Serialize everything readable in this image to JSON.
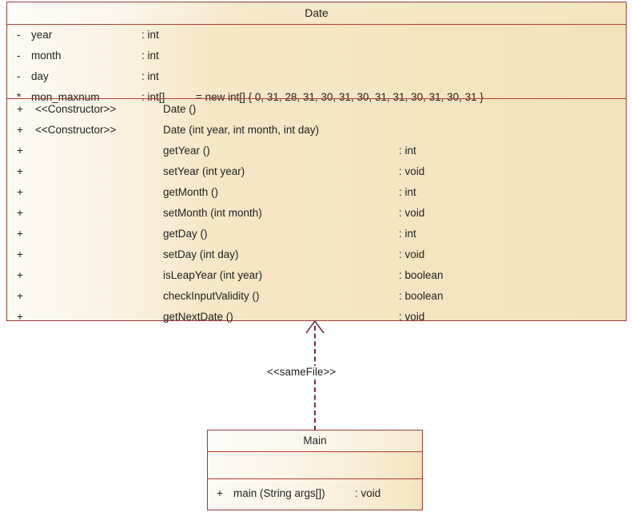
{
  "diagram": {
    "type": "uml-class-diagram",
    "background_color": "#ffffff",
    "class_border_color": "#9b3a35",
    "class_fill_start": "#fdfaf4",
    "class_fill_end": "#f4e2bb",
    "relationship_color": "#7a2a46"
  },
  "date_class": {
    "name": "Date",
    "attributes": [
      {
        "visibility": "-",
        "name": "year",
        "type": ": int",
        "initial": ""
      },
      {
        "visibility": "-",
        "name": "month",
        "type": ": int",
        "initial": ""
      },
      {
        "visibility": "-",
        "name": "day",
        "type": ": int",
        "initial": ""
      },
      {
        "visibility": "*",
        "name": "mon_maxnum",
        "type": ": int[]",
        "initial": "= new int[] { 0, 31, 28, 31, 30, 31, 30, 31, 31, 30, 31, 30, 31 }"
      }
    ],
    "operations": [
      {
        "visibility": "+",
        "stereotype": "<<Constructor>>",
        "signature": "Date ()",
        "returns": ""
      },
      {
        "visibility": "+",
        "stereotype": "<<Constructor>>",
        "signature": "Date (int year, int month, int day)",
        "returns": ""
      },
      {
        "visibility": "+",
        "stereotype": "",
        "signature": "getYear ()",
        "returns": ": int"
      },
      {
        "visibility": "+",
        "stereotype": "",
        "signature": "setYear (int year)",
        "returns": ": void"
      },
      {
        "visibility": "+",
        "stereotype": "",
        "signature": "getMonth ()",
        "returns": ": int"
      },
      {
        "visibility": "+",
        "stereotype": "",
        "signature": "setMonth (int month)",
        "returns": ": void"
      },
      {
        "visibility": "+",
        "stereotype": "",
        "signature": "getDay ()",
        "returns": ": int"
      },
      {
        "visibility": "+",
        "stereotype": "",
        "signature": "setDay (int day)",
        "returns": ": void"
      },
      {
        "visibility": "+",
        "stereotype": "",
        "signature": "isLeapYear (int year)",
        "returns": ": boolean"
      },
      {
        "visibility": "+",
        "stereotype": "",
        "signature": "checkInputValidity ()",
        "returns": ": boolean"
      },
      {
        "visibility": "+",
        "stereotype": "",
        "signature": "getNextDate ()",
        "returns": ": void"
      }
    ]
  },
  "main_class": {
    "name": "Main",
    "attributes": [],
    "operations": [
      {
        "visibility": "+",
        "signature": "main (String args[])",
        "returns": ": void"
      }
    ]
  },
  "relationship": {
    "label": "<<sameFile>>",
    "style": "dashed",
    "arrow": "open-triangle",
    "from": "Main",
    "to": "Date"
  }
}
